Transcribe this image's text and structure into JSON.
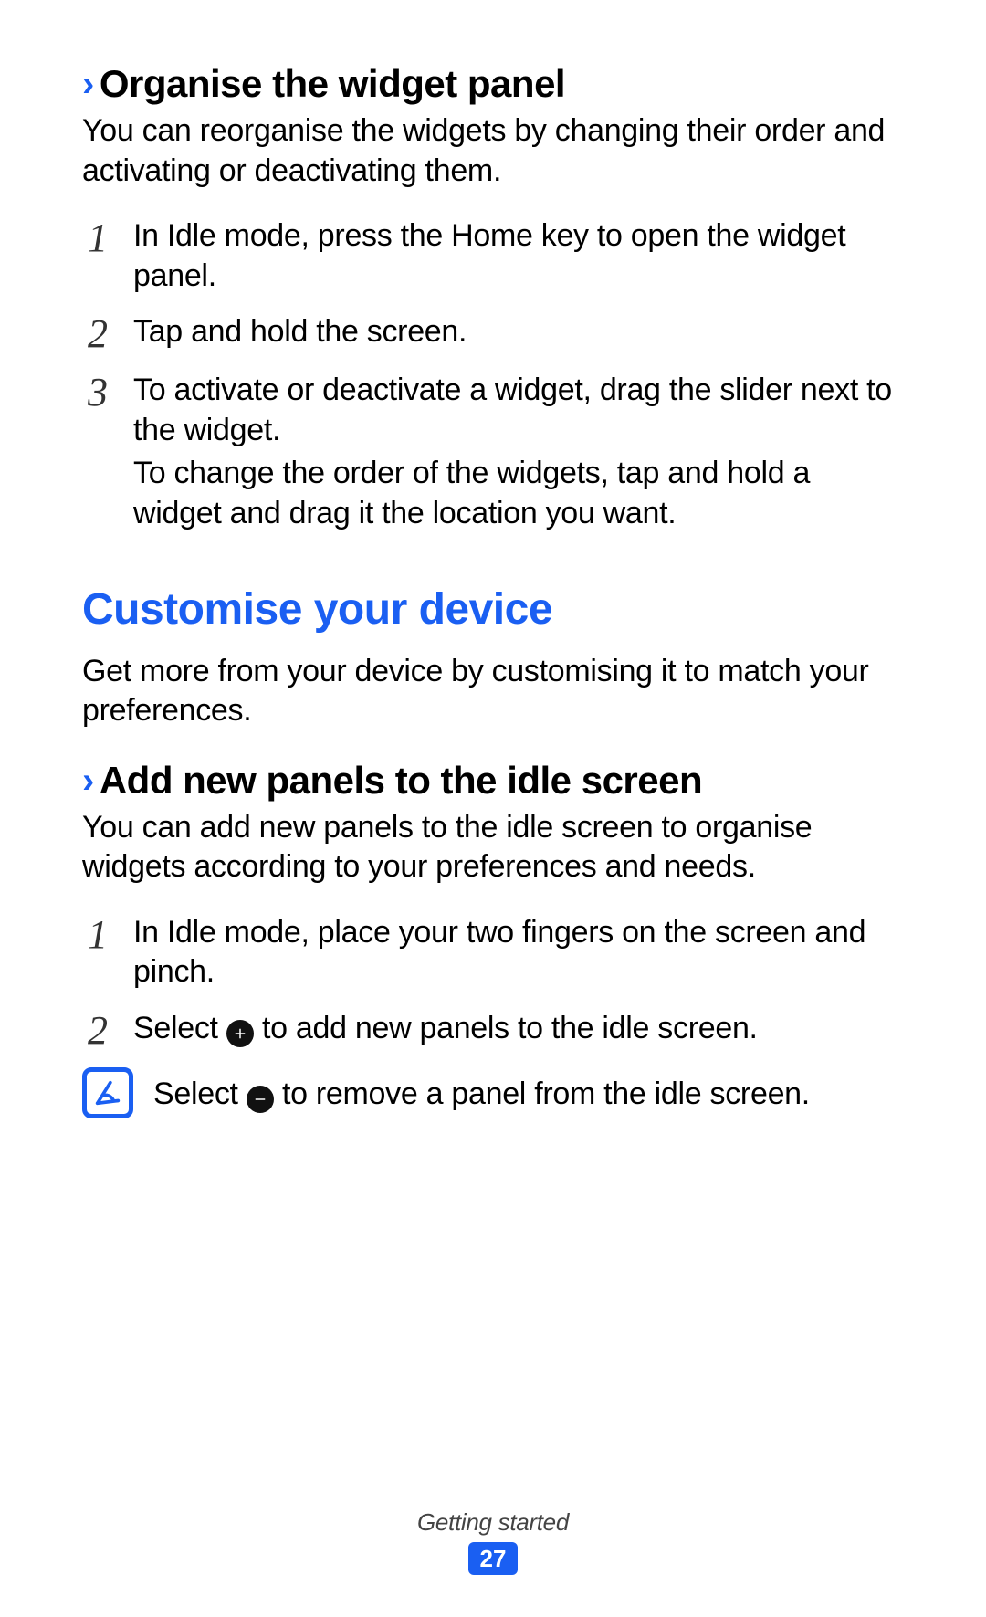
{
  "section1": {
    "heading": "Organise the widget panel",
    "intro": "You can reorganise the widgets by changing their order and activating or deactivating them.",
    "steps": [
      {
        "num": "1",
        "paras": [
          "In Idle mode, press the Home key to open the widget panel."
        ]
      },
      {
        "num": "2",
        "paras": [
          "Tap and hold the screen."
        ]
      },
      {
        "num": "3",
        "paras": [
          "To activate or deactivate a widget, drag the slider next to the widget.",
          "To change the order of the widgets, tap and hold a widget and drag it the location you want."
        ]
      }
    ]
  },
  "section2": {
    "title": "Customise your device",
    "intro": "Get more from your device by customising it to match your preferences.",
    "sub": {
      "heading": "Add new panels to the idle screen",
      "intro": "You can add new panels to the idle screen to organise widgets according to your preferences and needs.",
      "steps": [
        {
          "num": "1",
          "text": "In Idle mode, place your two fingers on the screen and pinch."
        },
        {
          "num": "2",
          "before": "Select ",
          "after": " to add new panels to the idle screen."
        }
      ],
      "note": {
        "before": "Select ",
        "after": " to remove a panel from the idle screen."
      }
    }
  },
  "footer": {
    "label": "Getting started",
    "page": "27"
  }
}
